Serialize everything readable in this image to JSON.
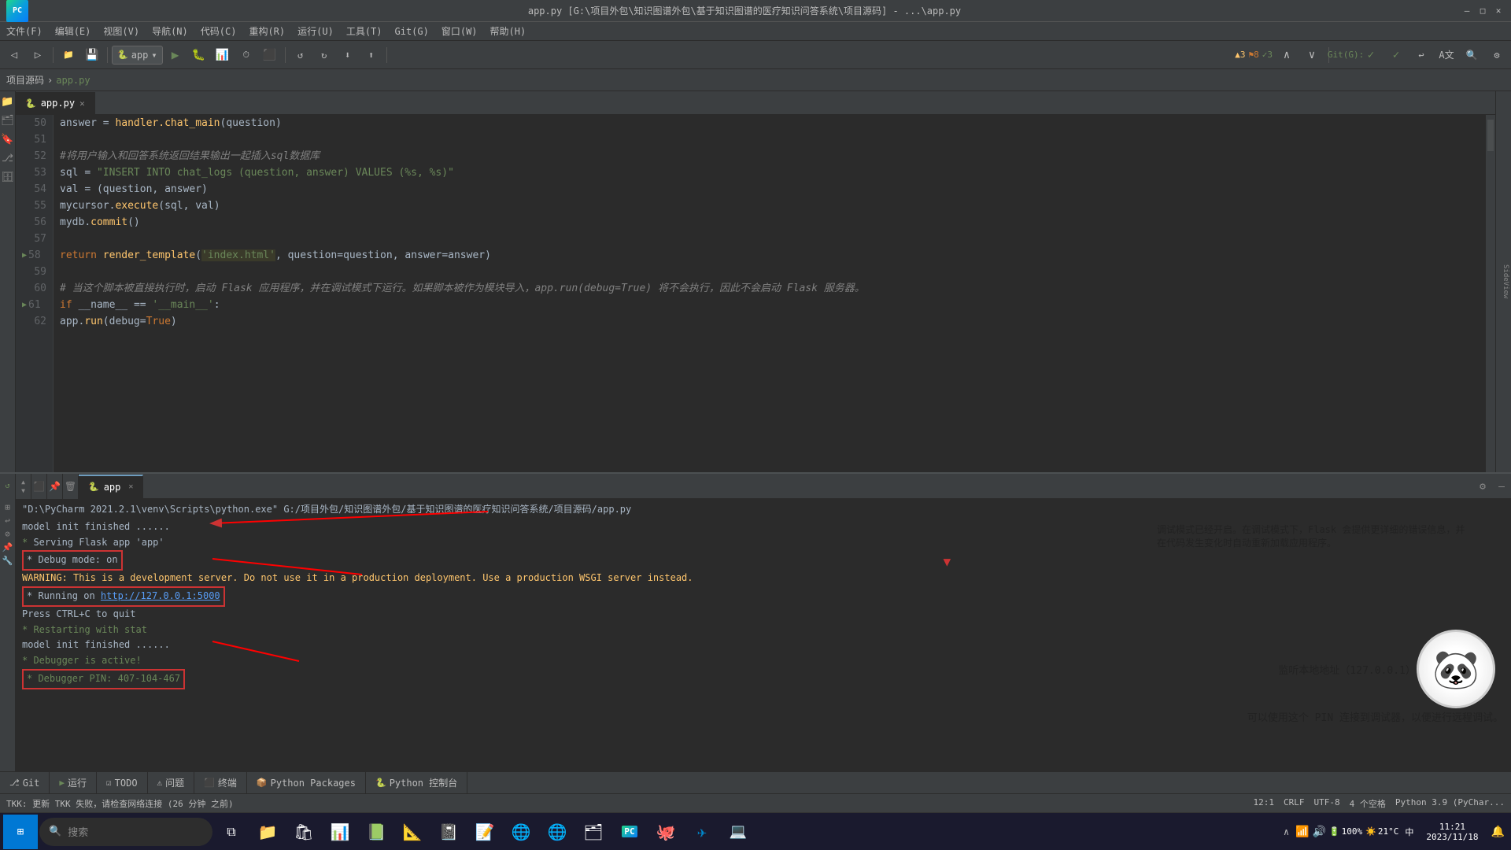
{
  "titlebar": {
    "title": "app.py [G:\\项目外包\\知识图谱外包\\基于知识图谱的医疗知识问答系统\\项目源码] - ...\\app.py",
    "minimize": "—",
    "maximize": "□",
    "close": "✕"
  },
  "menubar": {
    "items": [
      "文件(F)",
      "编辑(E)",
      "视图(V)",
      "导航(N)",
      "代码(C)",
      "重构(R)",
      "运行(U)",
      "工具(T)",
      "Git(G)",
      "窗口(W)",
      "帮助(H)"
    ]
  },
  "breadcrumb": {
    "project": "项目源码",
    "separator": "›",
    "file": "app.py"
  },
  "editor": {
    "tab": "app.py",
    "lines": [
      {
        "num": "50",
        "code": "    answer = handler.chat_main(question)",
        "type": "normal"
      },
      {
        "num": "51",
        "code": "",
        "type": "normal"
      },
      {
        "num": "52",
        "code": "    #将用户输入和回答系统返回结果输出一起插入sql数据库",
        "type": "comment"
      },
      {
        "num": "53",
        "code": "    sql = \"INSERT INTO chat_logs (question, answer) VALUES (%s, %s)\"",
        "type": "sql"
      },
      {
        "num": "54",
        "code": "    val = (question, answer)",
        "type": "normal"
      },
      {
        "num": "55",
        "code": "    mycursor.execute(sql, val)",
        "type": "normal"
      },
      {
        "num": "56",
        "code": "    mydb.commit()",
        "type": "normal"
      },
      {
        "num": "57",
        "code": "",
        "type": "normal"
      },
      {
        "num": "58",
        "code": "    return render_template('index.html', question=question, answer=answer)",
        "type": "return"
      },
      {
        "num": "59",
        "code": "",
        "type": "normal"
      },
      {
        "num": "60",
        "code": "# 当这个脚本被直接执行时，启动 Flask 应用程序，并在调试模式下运行。如果脚本被作为模块导入，app.run(debug=True) 将不会执行，因此不会启动 Flask 服务器。",
        "type": "comment"
      },
      {
        "num": "61",
        "code": "if __name__ == '__main__':",
        "type": "if"
      },
      {
        "num": "62",
        "code": "    app.run(debug=True)",
        "type": "normal"
      }
    ]
  },
  "run_panel": {
    "tab_label": "app",
    "command": "\"D:\\PyCharm 2021.2.1\\venv\\Scripts\\python.exe\" G:/项目外包/知识图谱外包/基于知识图谱的医疗知识问答系统/项目源码/app.py",
    "lines": [
      "model init finished ......",
      " * Serving Flask app 'app'",
      " * Debug mode: on",
      "WARNING: This is a development server. Do not use it in a production deployment. Use a production WSGI server instead.",
      " * Running on http://127.0.0.1:5000",
      "Press CTRL+C to quit",
      " * Restarting with stat",
      "model init finished ......",
      " * Debugger is active!",
      " * Debugger PIN: 407-104-467"
    ],
    "annotation1": "调试模式已经开启。在调试模式下，Flask 会提供更详细的错误信息，并在代码发生变化时自动重新加载应用程序。",
    "annotation2": "监听本地地址（127.0.0.1）的端口 5000。",
    "annotation3": "可以使用这个 PIN 连接到调试器，以便进行远程调试。"
  },
  "bottom_tabs": {
    "items": [
      {
        "icon": "⚙",
        "label": "Git"
      },
      {
        "icon": "▶",
        "label": "运行"
      },
      {
        "icon": "☑",
        "label": "TODO"
      },
      {
        "icon": "⚠",
        "label": "问题"
      },
      {
        "icon": "⬛",
        "label": "终端"
      },
      {
        "icon": "📦",
        "label": "Python Packages"
      },
      {
        "icon": "🐍",
        "label": "Python 控制台"
      }
    ]
  },
  "statusbar": {
    "message": "TKK: 更新 TKK 失败，请检查网络连接 (26 分钟 之前)",
    "line_col": "12:1",
    "line_ending": "CRLF",
    "encoding": "UTF-8",
    "indent": "4 个空格",
    "python": "Python 3.9 (PyChar..."
  },
  "taskbar": {
    "time": "11:21",
    "date": "2023/11/18",
    "temperature": "21°C",
    "battery": "100%",
    "search_placeholder": "搜索"
  },
  "warnings": {
    "count": "▲3  ⚑8  ✓3"
  }
}
